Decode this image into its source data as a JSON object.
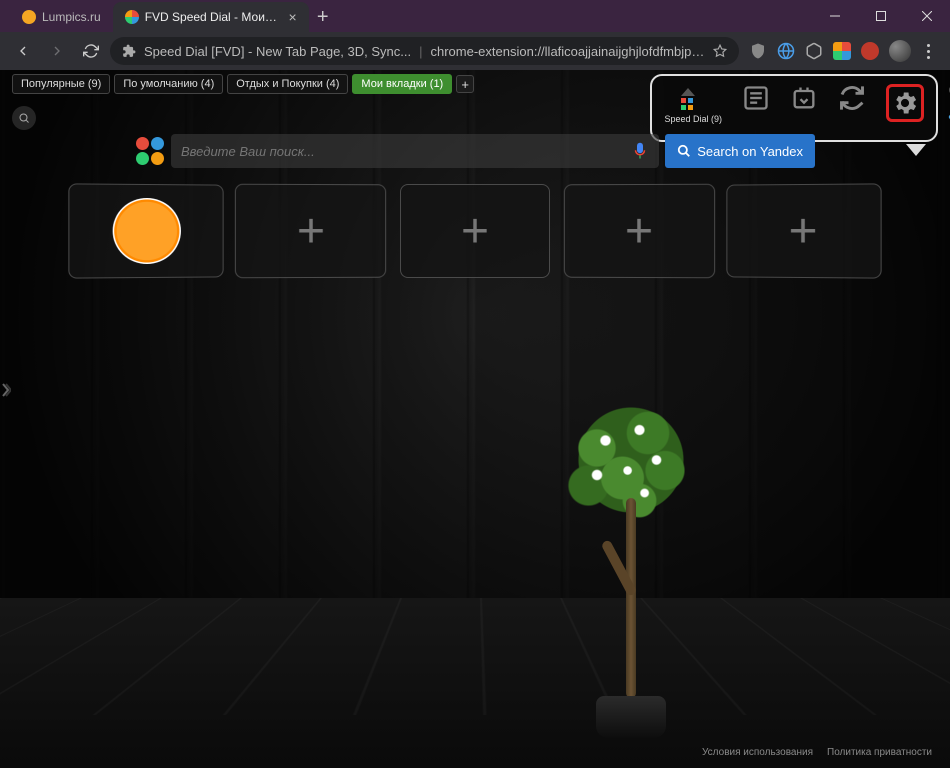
{
  "window": {
    "tabs": [
      {
        "title": "Lumpics.ru",
        "favicon_color": "#f5a623",
        "active": false
      },
      {
        "title": "FVD Speed Dial - Мои вкладки",
        "favicon_color": "multi",
        "active": true
      }
    ]
  },
  "addressbar": {
    "extension_name": "Speed Dial [FVD] - New Tab Page, 3D, Sync...",
    "url": "chrome-extension://llaficoajjainaijghjlofdfmbjpebpa/newtab.html"
  },
  "groups": [
    {
      "label": "Популярные (9)",
      "active": false
    },
    {
      "label": "По умолчанию (4)",
      "active": false
    },
    {
      "label": "Отдых и Покупки (4)",
      "active": false
    },
    {
      "label": "Мои вкладки (1)",
      "active": true
    }
  ],
  "toolpanel": {
    "speed_dial_label": "Speed Dial (9)"
  },
  "search": {
    "placeholder": "Введите Ваш поиск...",
    "yandex_label": "Search on Yandex"
  },
  "footer": {
    "terms": "Условия использования",
    "privacy": "Политика приватности"
  },
  "colors": {
    "accent_green": "#3e8e2f",
    "highlight_red": "#d22",
    "yandex_blue": "#2873c9"
  }
}
